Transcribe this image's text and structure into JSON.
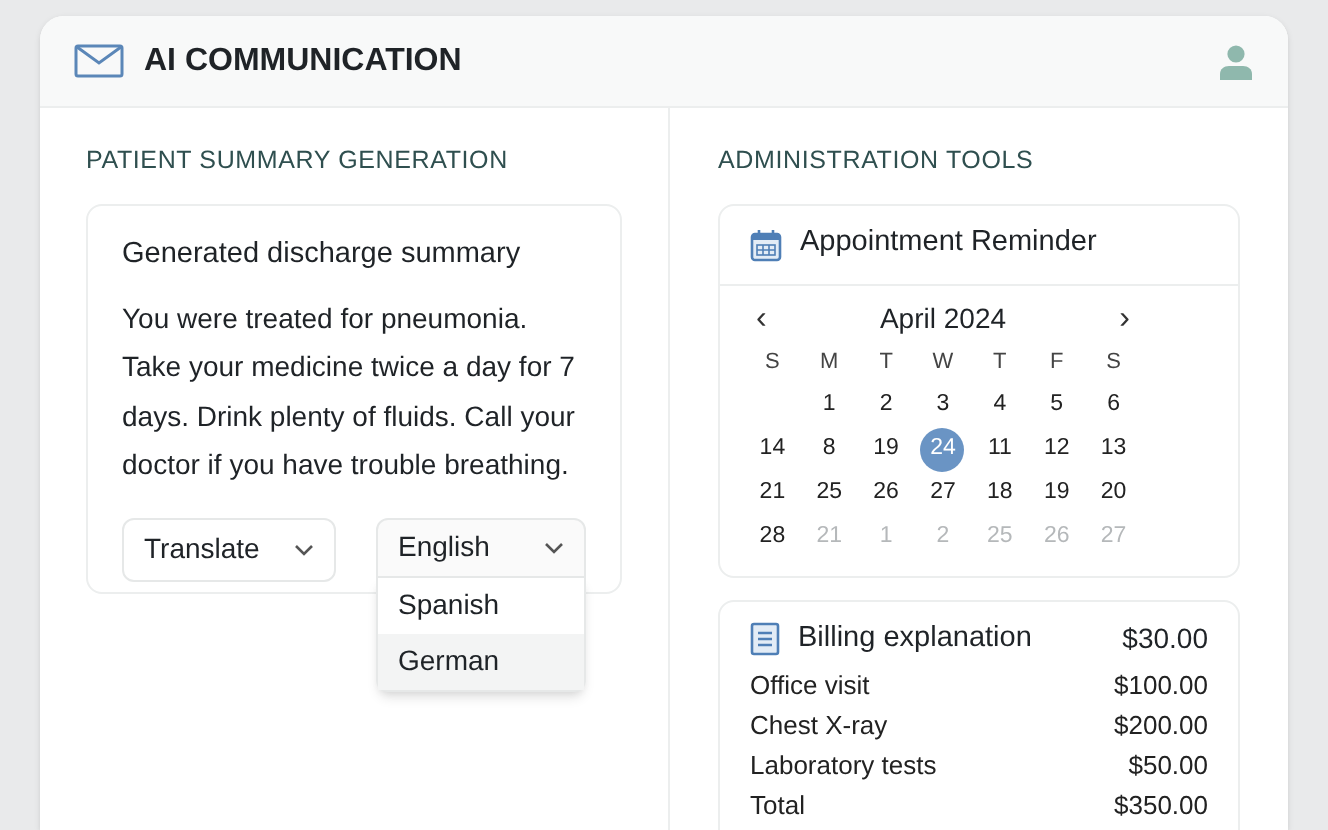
{
  "header": {
    "title": "AI COMMUNICATION"
  },
  "left": {
    "heading": "PATIENT SUMMARY GENERATION",
    "card_title": "Generated discharge summary",
    "summary": "You were treated for pneumonia. Take your medicine twice a day for 7 days. Drink plenty of fluids. Call your doctor if you have trouble breathing.",
    "translate_select": {
      "value": "Translate"
    },
    "language_select": {
      "value": "English",
      "expanded": true,
      "options": [
        {
          "label": "Spanish",
          "selected": false
        },
        {
          "label": "German",
          "selected": true
        }
      ]
    }
  },
  "right": {
    "heading": "ADMINISTRATION TOOLS",
    "calendar": {
      "title": "Appointment Reminder",
      "month": "April 2024",
      "prev": "‹",
      "next": "›",
      "weekdays": [
        "S",
        "M",
        "T",
        "W",
        "T",
        "F",
        "S"
      ],
      "weeks": [
        [
          {
            "day": "1",
            "selected": false,
            "muted": false
          },
          {
            "day": "2",
            "selected": false,
            "muted": false
          },
          {
            "day": "3",
            "selected": false,
            "muted": false
          },
          {
            "day": "4",
            "selected": false,
            "muted": false
          },
          {
            "day": "5",
            "selected": false,
            "muted": false
          },
          {
            "day": "6",
            "selected": false,
            "muted": false
          }
        ],
        [
          {
            "day": "14",
            "selected": false,
            "muted": false
          },
          {
            "day": "8",
            "selected": false,
            "muted": false
          },
          {
            "day": "19",
            "selected": false,
            "muted": false
          },
          {
            "day": "24",
            "selected": true,
            "muted": false
          },
          {
            "day": "11",
            "selected": false,
            "muted": false
          },
          {
            "day": "12",
            "selected": false,
            "muted": false
          },
          {
            "day": "13",
            "selected": false,
            "muted": false
          }
        ],
        [
          {
            "day": "21",
            "selected": false,
            "muted": false
          },
          {
            "day": "25",
            "selected": false,
            "muted": false
          },
          {
            "day": "26",
            "selected": false,
            "muted": false
          },
          {
            "day": "27",
            "selected": false,
            "muted": false
          },
          {
            "day": "18",
            "selected": false,
            "muted": false
          },
          {
            "day": "19",
            "selected": false,
            "muted": false
          },
          {
            "day": "20",
            "selected": false,
            "muted": false
          }
        ],
        [
          {
            "day": "28",
            "selected": false,
            "muted": false
          },
          {
            "day": "21",
            "selected": false,
            "muted": true
          },
          {
            "day": "1",
            "selected": false,
            "muted": true
          },
          {
            "day": "2",
            "selected": false,
            "muted": true
          },
          {
            "day": "25",
            "selected": false,
            "muted": true
          },
          {
            "day": "26",
            "selected": false,
            "muted": true
          },
          {
            "day": "27",
            "selected": false,
            "muted": true
          }
        ]
      ]
    },
    "billing": {
      "title": "Billing explanation",
      "amount": "$30.00",
      "items": [
        {
          "label": "Office visit",
          "amount": "$100.00"
        },
        {
          "label": "Chest X-ray",
          "amount": "$200.00"
        },
        {
          "label": "Laboratory tests",
          "amount": "$50.00"
        },
        {
          "label": "Total",
          "amount": "$350.00"
        }
      ]
    }
  }
}
